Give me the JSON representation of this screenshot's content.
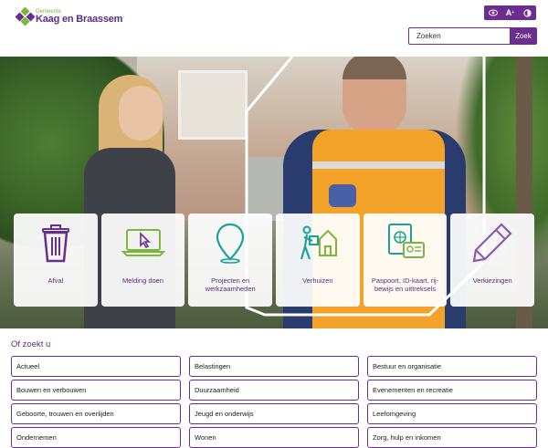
{
  "header": {
    "logo_small": "Gemeente",
    "logo_big": "Kaag en Braassem",
    "a11y": {
      "eye_label": "◉",
      "text_size_label": "A",
      "contrast_label": "◐"
    },
    "search": {
      "placeholder": "Zoeken",
      "button_label": "Zoek"
    }
  },
  "tiles": [
    {
      "label": "Afval",
      "icon": "trash-icon"
    },
    {
      "label": "Melding doen",
      "icon": "laptop-cursor-icon"
    },
    {
      "label": "Projecten en werkzaamheden",
      "icon": "map-pin-icon"
    },
    {
      "label": "Verhuizen",
      "icon": "moving-person-icon"
    },
    {
      "label": "Paspoort, ID-kaart, rij-bewijs en uittreksels",
      "icon": "passport-id-icon"
    },
    {
      "label": "Verkiezingen",
      "icon": "pencil-icon"
    }
  ],
  "of_zoekt_u": {
    "title": "Of zoekt u",
    "links": [
      "Actueel",
      "Belastingen",
      "Bestuur en organisatie",
      "Bouwen en verbouwen",
      "Duurzaamheid",
      "Evenementen en recreatie",
      "Geboorte, trouwen en overlijden",
      "Jeugd en onderwijs",
      "Leefomgeving",
      "Ondernemen",
      "Wonen",
      "Zorg, hulp en inkomen"
    ]
  },
  "colors": {
    "brand_purple": "#6b2d8e",
    "label_purple": "#5a2d82",
    "logo_green": "#7bb83a",
    "icon_teal": "#1aa39b",
    "icon_green": "#7bb83a"
  }
}
